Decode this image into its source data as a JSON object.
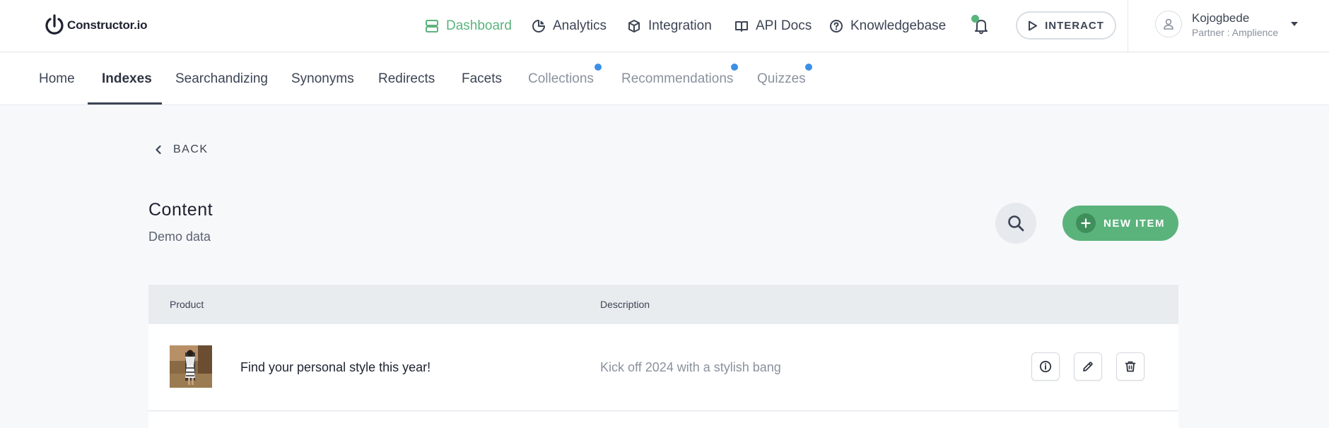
{
  "brand": {
    "name": "Constructor.io"
  },
  "topnav": {
    "items": [
      {
        "label": "Dashboard",
        "icon": "dashboard-icon",
        "active": true
      },
      {
        "label": "Analytics",
        "icon": "pie-chart-icon"
      },
      {
        "label": "Integration",
        "icon": "box-icon"
      },
      {
        "label": "API Docs",
        "icon": "book-icon"
      },
      {
        "label": "Knowledgebase",
        "icon": "help-circle-icon"
      }
    ],
    "interact_label": "INTERACT"
  },
  "user": {
    "name": "Kojogbede",
    "role": "Partner : Amplience"
  },
  "subnav": {
    "items": [
      {
        "label": "Home"
      },
      {
        "label": "Indexes",
        "active": true
      },
      {
        "label": "Searchandizing"
      },
      {
        "label": "Synonyms"
      },
      {
        "label": "Redirects"
      },
      {
        "label": "Facets"
      },
      {
        "label": "Collections",
        "badge": true
      },
      {
        "label": "Recommendations",
        "badge": true
      },
      {
        "label": "Quizzes",
        "badge": true
      }
    ]
  },
  "page": {
    "back_label": "BACK",
    "title": "Content",
    "subtitle": "Demo data",
    "new_item_label": "NEW ITEM"
  },
  "table": {
    "columns": [
      "Product",
      "Description"
    ],
    "rows": [
      {
        "product": "Find your personal style this year!",
        "description": "Kick off 2024 with a stylish bang"
      }
    ]
  },
  "colors": {
    "accent": "#5bb37c",
    "badge": "#3b8fe6",
    "text": "#3c4454"
  }
}
